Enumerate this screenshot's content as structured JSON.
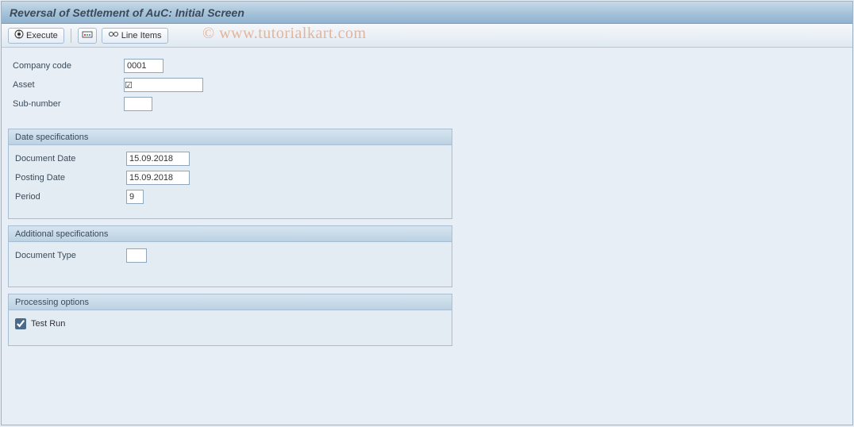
{
  "header": {
    "title": "Reversal of Settlement of AuC: Initial Screen"
  },
  "toolbar": {
    "execute_label": "Execute",
    "line_items_label": "Line Items"
  },
  "watermark": "© www.tutorialkart.com",
  "basic": {
    "company_code_label": "Company code",
    "company_code_value": "0001",
    "asset_label": "Asset",
    "asset_req": "☑",
    "asset_value": "",
    "subnumber_label": "Sub-number",
    "subnumber_value": ""
  },
  "date_spec": {
    "title": "Date specifications",
    "doc_date_label": "Document Date",
    "doc_date_value": "15.09.2018",
    "post_date_label": "Posting Date",
    "post_date_value": "15.09.2018",
    "period_label": "Period",
    "period_value": "9"
  },
  "add_spec": {
    "title": "Additional specifications",
    "doc_type_label": "Document Type",
    "doc_type_value": ""
  },
  "proc_opt": {
    "title": "Processing options",
    "test_run_label": "Test Run",
    "test_run_checked": true
  }
}
